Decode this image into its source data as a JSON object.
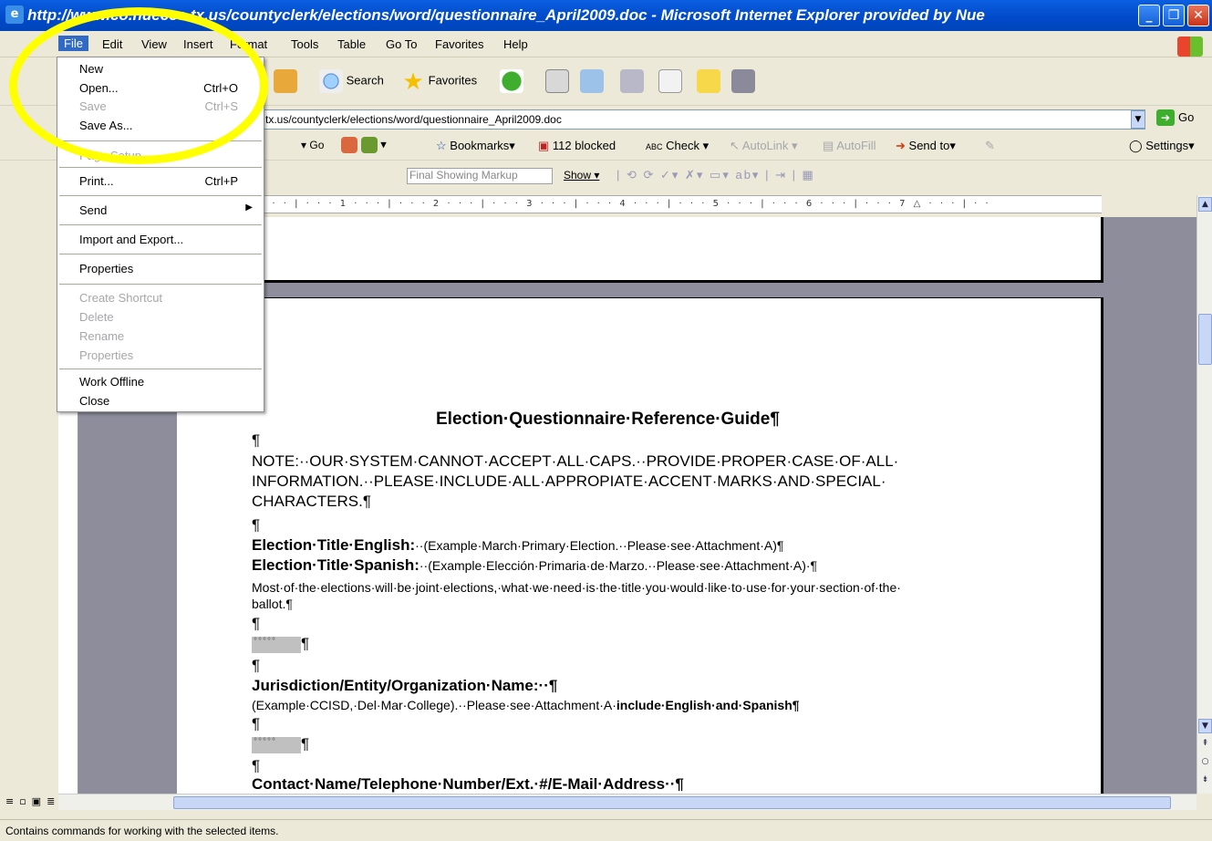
{
  "window": {
    "title": "http://www.co.nueces.tx.us/countyclerk/elections/word/questionnaire_April2009.doc - Microsoft Internet Explorer provided by Nue",
    "minimize": "_",
    "maximize": "❐",
    "close": "✕"
  },
  "menubar": {
    "items": [
      "File",
      "Edit",
      "View",
      "Insert",
      "Format",
      "Tools",
      "Table",
      "Go To",
      "Favorites",
      "Help"
    ]
  },
  "file_menu": {
    "items": [
      {
        "label": "New",
        "shortcut": "",
        "enabled": true
      },
      {
        "label": "Open...",
        "shortcut": "Ctrl+O",
        "enabled": true
      },
      {
        "label": "Save",
        "shortcut": "Ctrl+S",
        "enabled": false
      },
      {
        "label": "Save As...",
        "shortcut": "",
        "enabled": true
      },
      {
        "label": "Page Setup...",
        "shortcut": "",
        "enabled": false
      },
      {
        "label": "Print...",
        "shortcut": "Ctrl+P",
        "enabled": true
      },
      {
        "label": "Send",
        "shortcut": "",
        "enabled": true,
        "submenu": "▶"
      },
      {
        "label": "Import and Export...",
        "shortcut": "",
        "enabled": true
      },
      {
        "label": "Properties",
        "shortcut": "",
        "enabled": true
      },
      {
        "label": "Create Shortcut",
        "shortcut": "",
        "enabled": false
      },
      {
        "label": "Delete",
        "shortcut": "",
        "enabled": false
      },
      {
        "label": "Rename",
        "shortcut": "",
        "enabled": false
      },
      {
        "label": "Properties",
        "shortcut": "",
        "enabled": false
      },
      {
        "label": "Work Offline",
        "shortcut": "",
        "enabled": true
      },
      {
        "label": "Close",
        "shortcut": "",
        "enabled": true
      }
    ]
  },
  "toolbar": {
    "search": "Search",
    "favorites": "Favorites"
  },
  "address": {
    "url": "tx.us/countyclerk/elections/word/questionnaire_April2009.doc",
    "go": "Go"
  },
  "links_toolbar": {
    "go": "Go",
    "bookmarks": "Bookmarks▾",
    "blocked": "112 blocked",
    "check": "Check ▾",
    "autolink": "AutoLink ▾",
    "autofill": "AutoFill",
    "send_to": "Send to▾",
    "settings": "Settings▾"
  },
  "reviewing": {
    "markup": "Final Showing Markup",
    "show": "Show ▾"
  },
  "ruler": {
    "text": "· · · | · · · 1 · · · | · · · 2 · · · | · · · 3 · · · | · · · 4 · · · | · · · 5 · · · | · · · 6 · · · | · · · 7 △ · · · | · ·"
  },
  "document": {
    "heading": "Election·Questionnaire·Reference·Guide¶",
    "pilcrow": "¶",
    "note1": "NOTE:··OUR·SYSTEM·CANNOT·ACCEPT·ALL·CAPS.··PROVIDE·PROPER·CASE·OF·ALL·",
    "note2": "INFORMATION.··PLEASE·INCLUDE·ALL·APPROPIATE·ACCENT·MARKS·AND·SPECIAL·",
    "note3": "CHARACTERS.¶",
    "title_en_label": "Election·Title·English:",
    "title_en_text": "··(Example·March·Primary·Election.··Please·see·Attachment·A)¶",
    "title_es_label": "Election·Title·Spanish:",
    "title_es_text": "··(Example·Elección·Primaria·de·Marzo.··Please·see·Attachment·A)·¶",
    "joint1": "Most·of·the·elections·will·be·joint·elections,·what·we·need·is·the·title·you·would·like·to·use·for·your·section·of·the·",
    "joint2": "ballot.¶",
    "field_dots": "°°°°°",
    "jurisdiction_label": "Jurisdiction/Entity/Organization·Name:··¶",
    "jurisdiction_text": "(Example·CCISD,·Del·Mar·College).··Please·see·Attachment·A·",
    "jurisdiction_bold": "include·English·and·Spanish¶",
    "contact_label": "Contact·Name/Telephone·Number/Ext.·#/E-Mail·Address··¶"
  },
  "status": {
    "text": "Contains commands for working with the selected items."
  }
}
